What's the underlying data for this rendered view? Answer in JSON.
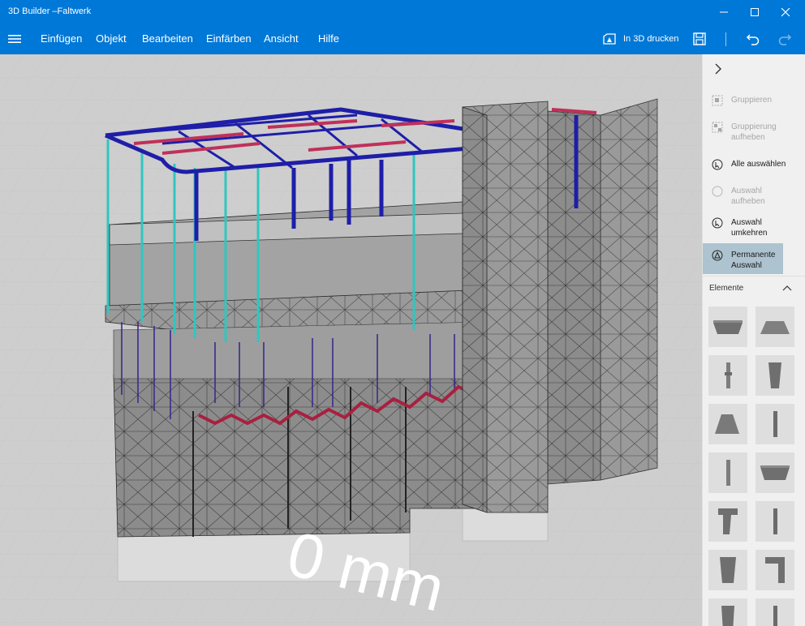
{
  "window": {
    "title": "3D Builder –Faltwerk",
    "controls": [
      "minimize-icon",
      "maximize-icon",
      "close-icon"
    ],
    "accent": "#0078d7"
  },
  "menu": {
    "items": [
      "Einfügen",
      "Objekt",
      "Bearbeiten",
      "Einfärben",
      "Ansicht",
      "Hilfe"
    ],
    "print_label": "In 3D drucken",
    "icons": [
      "hamburger-icon",
      "print-3d-icon",
      "save-icon",
      "undo-icon",
      "redo-icon"
    ]
  },
  "viewport": {
    "floor_label": "0 mm",
    "background": "#cfcfcf",
    "model_colors": {
      "mesh": "#8f8f8f",
      "beam": "#1e1ea8",
      "column": "#2fc7c0",
      "highlight": "#c0305a"
    }
  },
  "panel": {
    "actions": [
      {
        "label": "Gruppieren",
        "icon": "group-icon",
        "disabled": true
      },
      {
        "label": "Gruppierung aufheben",
        "icon": "ungroup-icon",
        "disabled": true
      },
      {
        "label": "Alle auswählen",
        "icon": "select-all-icon",
        "disabled": false
      },
      {
        "label": "Auswahl aufheben",
        "icon": "deselect-icon",
        "disabled": true
      },
      {
        "label": "Auswahl umkehren",
        "icon": "invert-selection-icon",
        "disabled": false
      },
      {
        "label": "Permanente Auswahl",
        "icon": "permanent-selection-icon",
        "disabled": false,
        "active": true
      }
    ],
    "elements_header": "Elemente",
    "active_color": "#adc3cf"
  }
}
